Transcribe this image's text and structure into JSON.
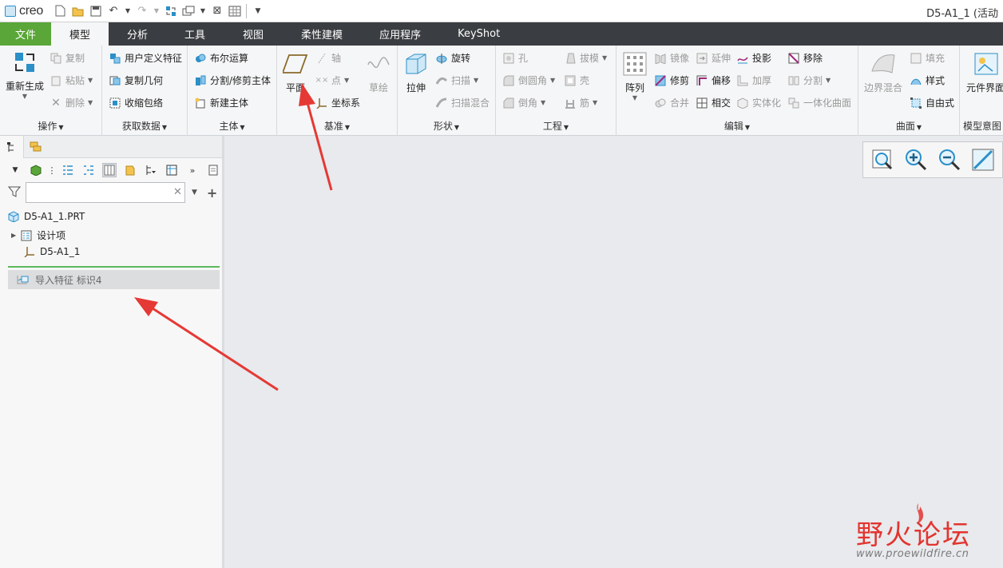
{
  "app": {
    "logo": "creo",
    "window_title": "D5-A1_1 (活动"
  },
  "quick_access": {
    "icons": [
      "new-icon",
      "open-icon",
      "save-icon",
      "undo-icon",
      "redo-icon",
      "regenerate-icon",
      "windows-icon",
      "close-window-icon",
      "settings-icon"
    ]
  },
  "tabs": [
    "文件",
    "模型",
    "分析",
    "工具",
    "视图",
    "柔性建模",
    "应用程序",
    "KeyShot"
  ],
  "ribbon": {
    "operations": {
      "title": "操作",
      "regen": "重新生成",
      "copy": "复制",
      "paste": "粘贴",
      "delete": "删除"
    },
    "get_data": {
      "title": "获取数据",
      "udf": "用户定义特征",
      "copy_geom": "复制几何",
      "shrinkwrap": "收缩包络"
    },
    "body": {
      "title": "主体",
      "boolean": "布尔运算",
      "split": "分割/修剪主体",
      "new_body": "新建主体"
    },
    "datum": {
      "title": "基准",
      "plane": "平面",
      "axis": "轴",
      "point": "点",
      "csys": "坐标系",
      "sketch": "草绘"
    },
    "shapes": {
      "title": "形状",
      "extrude": "拉伸",
      "revolve": "旋转",
      "sweep": "扫描",
      "swept_blend": "扫描混合"
    },
    "engineering": {
      "title": "工程",
      "hole": "孔",
      "round": "倒圆角",
      "chamfer": "倒角",
      "draft": "拔模",
      "shell": "壳",
      "rib": "筋"
    },
    "editing": {
      "title": "编辑",
      "pattern": "阵列",
      "mirror": "镜像",
      "extend": "延伸",
      "project": "投影",
      "trim": "修剪",
      "offset": "偏移",
      "thicken": "加厚",
      "merge": "合并",
      "intersect": "相交",
      "solidify": "实体化",
      "remove": "移除",
      "split": "分割",
      "unify": "一体化曲面"
    },
    "surfaces": {
      "title": "曲面",
      "boundary": "边界混合",
      "fill": "填充",
      "style": "样式",
      "freestyle": "自由式"
    },
    "model_intent": {
      "title": "模型意图",
      "component_interface": "元件界面"
    }
  },
  "left_panel": {
    "search_placeholder": "",
    "tree": {
      "root": "D5-A1_1.PRT",
      "design_items": "设计项",
      "csys": "D5-A1_1",
      "import_feature": "导入特征 标识4"
    }
  },
  "watermark": {
    "title": "野火论坛",
    "url": "www.proewildfire.cn"
  },
  "colors": {
    "tab_bar": "#3a3d41",
    "file_tab": "#5aa638",
    "arrow": "#e53935",
    "watermark": "#e3342f"
  }
}
